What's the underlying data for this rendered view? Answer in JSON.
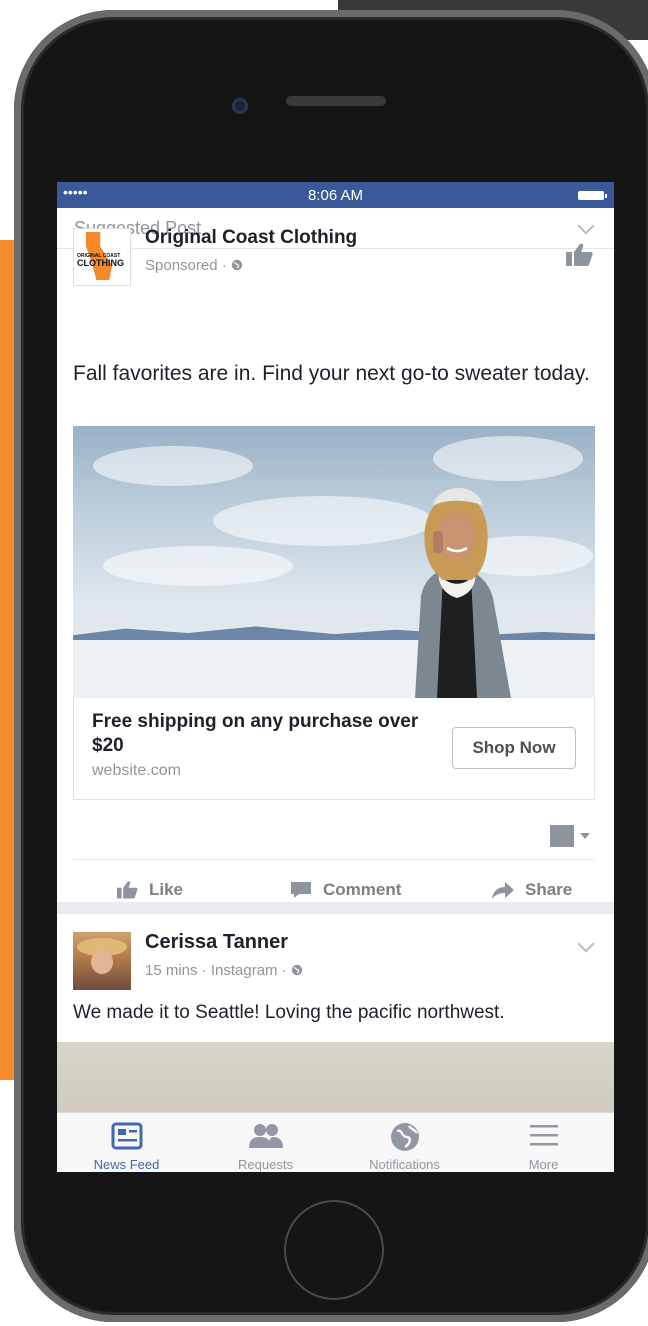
{
  "status_bar": {
    "signal": "•••••",
    "time": "8:06 AM"
  },
  "post": {
    "suggested_label": "Suggested Post",
    "author": "Original Coast Clothing",
    "logo_text": "ORIGINAL COAST CLOTHING",
    "meta": "Sponsored · ",
    "caption": "Fall favorites are in. Find your next go-to sweater today.",
    "link_title": "Free shipping on any purchase over $20",
    "link_url": "website.com",
    "cta_label": "Shop Now",
    "actions": {
      "like": "Like",
      "comment": "Comment",
      "share": "Share"
    }
  },
  "post2": {
    "author": "Cerissa Tanner",
    "meta": "15 mins · Instagram · ",
    "caption": "We made it to Seattle! Loving the pacific northwest."
  },
  "tabs": [
    {
      "label": "News Feed",
      "icon": "news-feed-icon",
      "active": true
    },
    {
      "label": "Requests",
      "icon": "friends-icon",
      "active": false
    },
    {
      "label": "Notifications",
      "icon": "globe-icon",
      "active": false
    },
    {
      "label": "More",
      "icon": "menu-icon",
      "active": false
    }
  ],
  "colors": {
    "brand_blue": "#3b5998",
    "accent_orange": "#f68b2a",
    "tab_active": "#4267b2"
  }
}
